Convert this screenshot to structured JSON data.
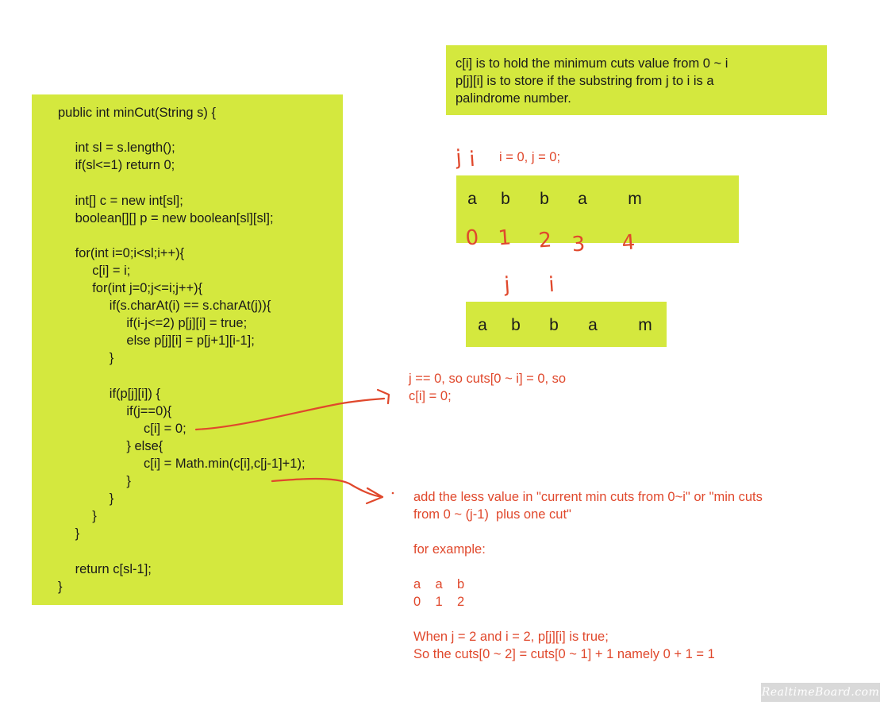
{
  "code": {
    "lines": [
      "public int minCut(String s) {",
      "",
      "    int sl = s.length();",
      "    if(sl<=1) return 0;",
      "",
      "    int[] c = new int[sl];",
      "    boolean[][] p = new boolean[sl][sl];",
      "",
      "    for(int i=0;i<sl;i++){",
      "        c[i] = i;",
      "        for(int j=0;j<=i;j++){",
      "            if(s.charAt(i) == s.charAt(j)){",
      "                if(i-j<=2) p[j][i] = true;",
      "                else p[j][i] = p[j+1][i-1];",
      "            }",
      "",
      "            if(p[j][i]) {",
      "                if(j==0){",
      "                    c[i] = 0;",
      "                } else{",
      "                    c[i] = Math.min(c[i],c[j-1]+1);",
      "                }",
      "            }",
      "        }",
      "    }",
      "",
      "    return c[sl-1];",
      "}"
    ]
  },
  "info": {
    "lines": [
      "c[i] is to hold the minimum cuts value from 0 ~ i",
      "p[j][i] is to store if the substring from j to i is a",
      "palindrome number."
    ]
  },
  "example1": {
    "annotation": "i = 0, j = 0;",
    "pointers": [
      "j",
      "i"
    ],
    "chars": [
      "a",
      "b",
      "b",
      "a",
      "m"
    ],
    "indices": [
      "0",
      "1",
      "2",
      "3",
      "4"
    ]
  },
  "example2": {
    "pointers": [
      "j",
      "i"
    ],
    "chars": [
      "a",
      "b",
      "b",
      "a",
      "m"
    ]
  },
  "note1": {
    "lines": [
      "j == 0, so cuts[0 ~ i] = 0, so",
      "c[i] = 0;"
    ]
  },
  "note2": {
    "lines": [
      "add the less value in \"current min cuts from 0~i\" or \"min cuts",
      "from 0 ~ (j-1)  plus one cut\"",
      "",
      "for example:",
      "",
      "a    a    b",
      "0    1    2",
      "",
      "When j = 2 and i = 2, p[j][i] is true;",
      "So the cuts[0 ~ 2] = cuts[0 ~ 1] + 1 namely 0 + 1 = 1"
    ]
  },
  "watermark": "RealtimeBoard.com",
  "colors": {
    "sticky": "#d4e83e",
    "annotation": "#e0482c",
    "text": "#1a1a1a"
  }
}
